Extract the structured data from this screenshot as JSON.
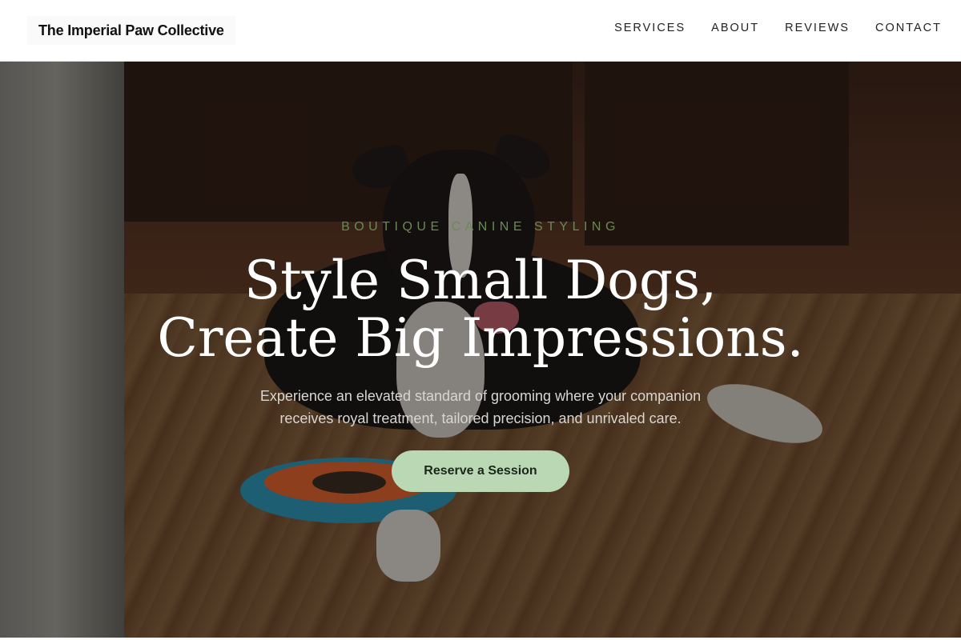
{
  "header": {
    "brand": "The Imperial Paw Collective",
    "nav": [
      "SERVICES",
      "ABOUT",
      "REVIEWS",
      "CONTACT"
    ]
  },
  "hero": {
    "eyebrow": "BOUTIQUE CANINE STYLING",
    "title_line1": "Style Small Dogs,",
    "title_line2": "Create Big Impressions.",
    "subtitle_line1": "Experience an elevated standard of grooming where your companion",
    "subtitle_line2": "receives royal treatment, tailored precision, and unrivaled care.",
    "cta_label": "Reserve a Session"
  },
  "colors": {
    "accent": "#b9d8b3",
    "eyebrow": "#6a8a52",
    "header_bg": "#ffffff",
    "title": "#ffffff"
  }
}
